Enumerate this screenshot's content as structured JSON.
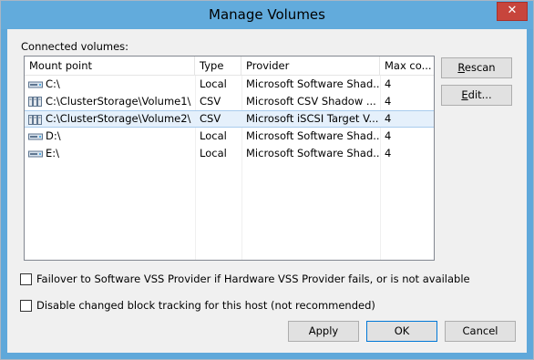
{
  "window": {
    "title": "Manage Volumes",
    "close_glyph": "✕"
  },
  "list": {
    "caption": "Connected volumes:",
    "columns": [
      "Mount point",
      "Type",
      "Provider",
      "Max co..."
    ],
    "rows": [
      {
        "mount": "C:\\",
        "type": "Local",
        "provider": "Microsoft Software Shad...",
        "max": "4",
        "icon": "local-disk-icon"
      },
      {
        "mount": "C:\\ClusterStorage\\Volume1\\",
        "type": "CSV",
        "provider": "Microsoft CSV Shadow ...",
        "max": "4",
        "icon": "cluster-volume-icon"
      },
      {
        "mount": "C:\\ClusterStorage\\Volume2\\",
        "type": "CSV",
        "provider": "Microsoft iSCSI Target V...",
        "max": "4",
        "icon": "cluster-volume-icon",
        "selected": true
      },
      {
        "mount": "D:\\",
        "type": "Local",
        "provider": "Microsoft Software Shad...",
        "max": "4",
        "icon": "local-disk-icon"
      },
      {
        "mount": "E:\\",
        "type": "Local",
        "provider": "Microsoft Software Shad...",
        "max": "4",
        "icon": "local-disk-icon"
      }
    ]
  },
  "side_buttons": {
    "rescan_rest": "escan",
    "rescan_key": "R",
    "edit_key": "E",
    "edit_rest": "dit..."
  },
  "options": {
    "failover_label": "Failover to Software VSS Provider if Hardware VSS Provider fails, or is not available",
    "failover_checked": false,
    "cbt_label": "Disable changed block tracking for this host (not recommended)",
    "cbt_checked": false
  },
  "footer": {
    "apply": "Apply",
    "ok": "OK",
    "cancel": "Cancel"
  }
}
